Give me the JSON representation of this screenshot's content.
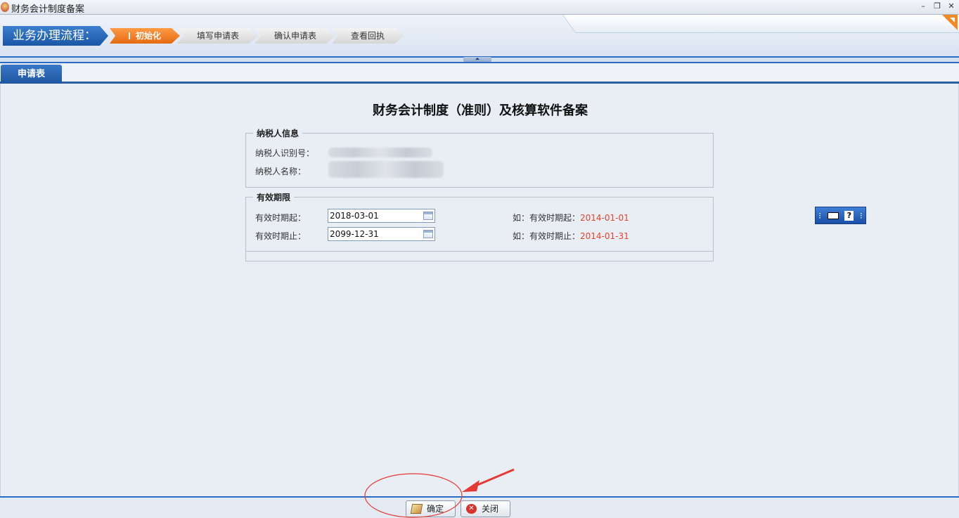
{
  "window": {
    "title": "财务会计制度备案",
    "controls": [
      "–",
      "❐",
      "✕"
    ]
  },
  "process": {
    "label": "业务办理流程：",
    "steps": [
      {
        "label": "初始化",
        "active": true
      },
      {
        "label": "填写申请表",
        "active": false
      },
      {
        "label": "确认申请表",
        "active": false
      },
      {
        "label": "查看回执",
        "active": false
      }
    ]
  },
  "tabs": [
    {
      "label": "申请表"
    }
  ],
  "form": {
    "title": "财务会计制度（准则）及核算软件备案",
    "taxpayer": {
      "legend": "纳税人信息",
      "id_label": "纳税人识别号：",
      "name_label": "纳税人名称："
    },
    "validity": {
      "legend": "有效期限",
      "start_label": "有效时期起：",
      "start_value": "2018-03-01",
      "end_label": "有效时期止：",
      "end_value": "2099-12-31",
      "start_hint_prefix": "如：有效时期起：",
      "start_hint_example": "2014-01-01",
      "end_hint_prefix": "如：有效时期止：",
      "end_hint_example": "2014-01-31"
    }
  },
  "mini_toolbar": {
    "help_glyph": "?"
  },
  "footer": {
    "ok_label": "确定",
    "close_label": "关闭"
  },
  "colors": {
    "accent_blue": "#2a6cc4",
    "active_step": "#e46a12",
    "hint_red": "#e8412c",
    "annotation_red": "#e53935"
  }
}
